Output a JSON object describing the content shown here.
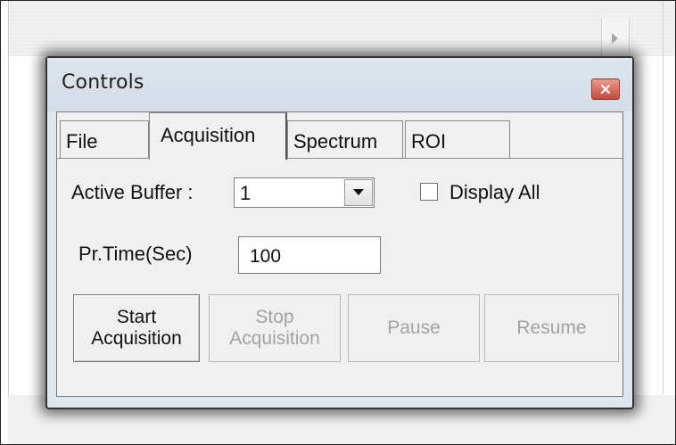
{
  "window": {
    "title": "Controls",
    "close_icon": "close-icon"
  },
  "tabs": [
    {
      "label": "File",
      "active": false
    },
    {
      "label": "Acquisition",
      "active": true
    },
    {
      "label": "Spectrum",
      "active": false
    },
    {
      "label": "ROI",
      "active": false
    }
  ],
  "acquisition": {
    "active_buffer_label": "Active Buffer :",
    "active_buffer_value": "1",
    "display_all_label": "Display All",
    "display_all_checked": false,
    "pr_time_label": "Pr.Time(Sec)",
    "pr_time_value": "100"
  },
  "buttons": {
    "start_line1": "Start",
    "start_line2": "Acquisition",
    "stop_line1": "Stop",
    "stop_line2": "Acquisition",
    "pause": "Pause",
    "resume": "Resume"
  },
  "colors": {
    "window_frame": "#dfe6ee",
    "close_button": "#c74a3c",
    "disabled_text": "#a3a3a3"
  }
}
